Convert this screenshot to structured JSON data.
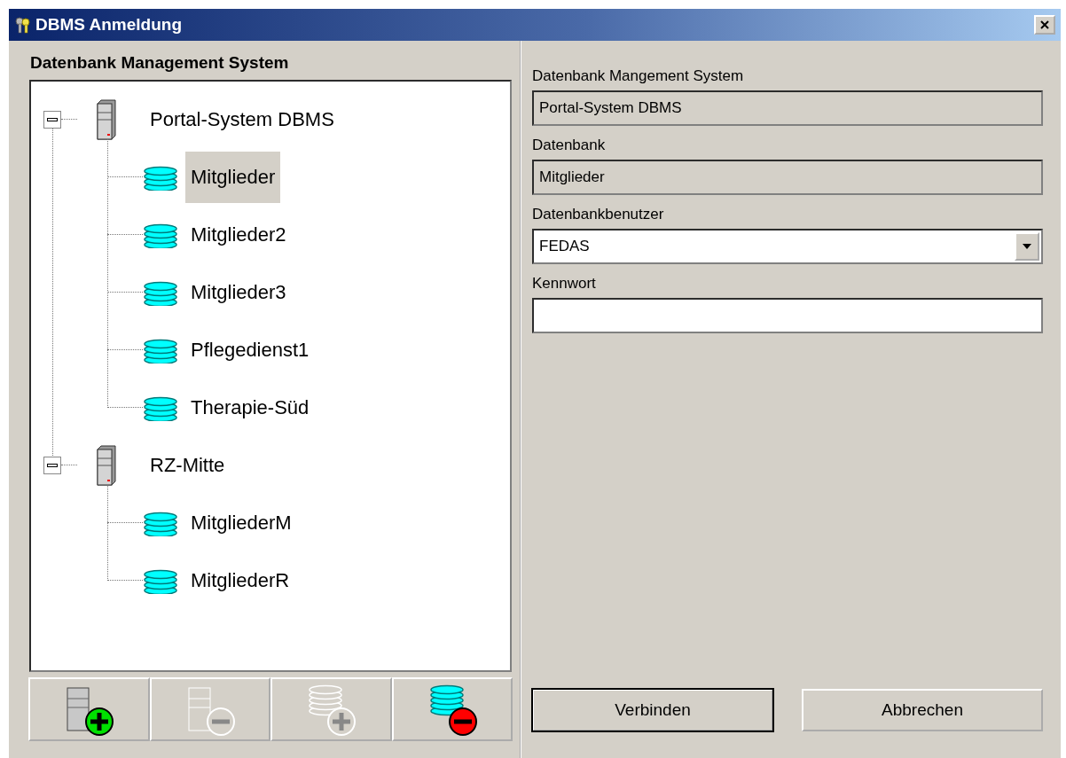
{
  "window": {
    "title": "DBMS Anmeldung"
  },
  "tree_panel": {
    "heading": "Datenbank Management System",
    "items": [
      {
        "kind": "server",
        "label": "Portal-System DBMS",
        "selected": false,
        "expanded": true,
        "children": [
          {
            "kind": "database",
            "label": "Mitglieder",
            "selected": true
          },
          {
            "kind": "database",
            "label": "Mitglieder2",
            "selected": false
          },
          {
            "kind": "database",
            "label": "Mitglieder3",
            "selected": false
          },
          {
            "kind": "database",
            "label": "Pflegedienst1",
            "selected": false
          },
          {
            "kind": "database",
            "label": "Therapie-Süd",
            "selected": false
          }
        ]
      },
      {
        "kind": "server",
        "label": "RZ-Mitte",
        "selected": false,
        "expanded": true,
        "children": [
          {
            "kind": "database",
            "label": "MitgliederM",
            "selected": false
          },
          {
            "kind": "database",
            "label": "MitgliederR",
            "selected": false
          }
        ]
      }
    ],
    "toolbar": [
      {
        "kind": "add-server",
        "disabled": false
      },
      {
        "kind": "remove-server",
        "disabled": true
      },
      {
        "kind": "add-database",
        "disabled": true
      },
      {
        "kind": "remove-database",
        "disabled": false
      }
    ]
  },
  "form": {
    "fields": [
      {
        "kind": "readonly",
        "label": "Datenbank Mangement System",
        "value": "Portal-System DBMS"
      },
      {
        "kind": "readonly",
        "label": "Datenbank",
        "value": "Mitglieder"
      },
      {
        "kind": "dropdown",
        "label": "Datenbankbenutzer",
        "value": "FEDAS"
      },
      {
        "kind": "password",
        "label": "Kennwort"
      }
    ],
    "buttons": [
      {
        "label": "Verbinden",
        "default": true
      },
      {
        "label": "Abbrechen",
        "default": false
      }
    ]
  }
}
